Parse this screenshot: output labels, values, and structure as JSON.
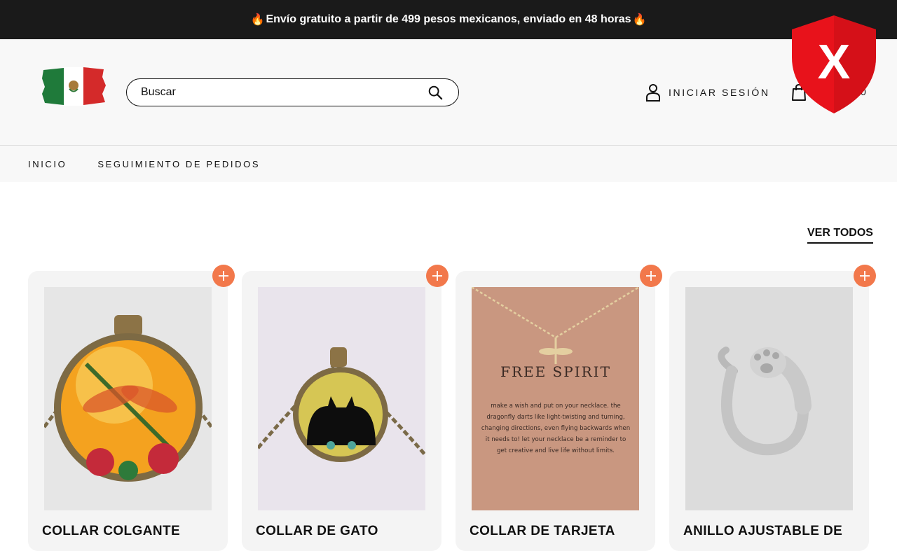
{
  "announcement": {
    "text": "Envío gratuito a partir de 499 pesos mexicanos, enviado en 48 horas",
    "flame_icon": "fire-emoji"
  },
  "header": {
    "search": {
      "placeholder": "Buscar"
    },
    "login_label": "INICIAR SESIÓN",
    "cart_count": "0",
    "shield_mark": "X"
  },
  "nav": {
    "items": [
      {
        "label": "INICIO"
      },
      {
        "label": "SEGUIMIENTO DE PEDIDOS"
      }
    ]
  },
  "collection": {
    "view_all_label": "VER TODOS"
  },
  "products": [
    {
      "title": "COLLAR COLGANTE"
    },
    {
      "title": "COLLAR DE GATO"
    },
    {
      "title": "COLLAR DE TARJETA",
      "card_heading": "FREE SPIRIT",
      "card_text": [
        "make a wish and put on your necklace. the",
        "dragonfly darts like light-twisting and turning,",
        "changing directions, even flying backwards when",
        "it needs to! let your necklace be a reminder to",
        "get creative and live life without limits."
      ]
    },
    {
      "title": "ANILLO AJUSTABLE DE"
    }
  ],
  "colors": {
    "announcement_bg": "#1a1a1a",
    "accent_orange": "#f2784b",
    "shield_red": "#e8121b",
    "header_bg": "#f8f8f8"
  }
}
